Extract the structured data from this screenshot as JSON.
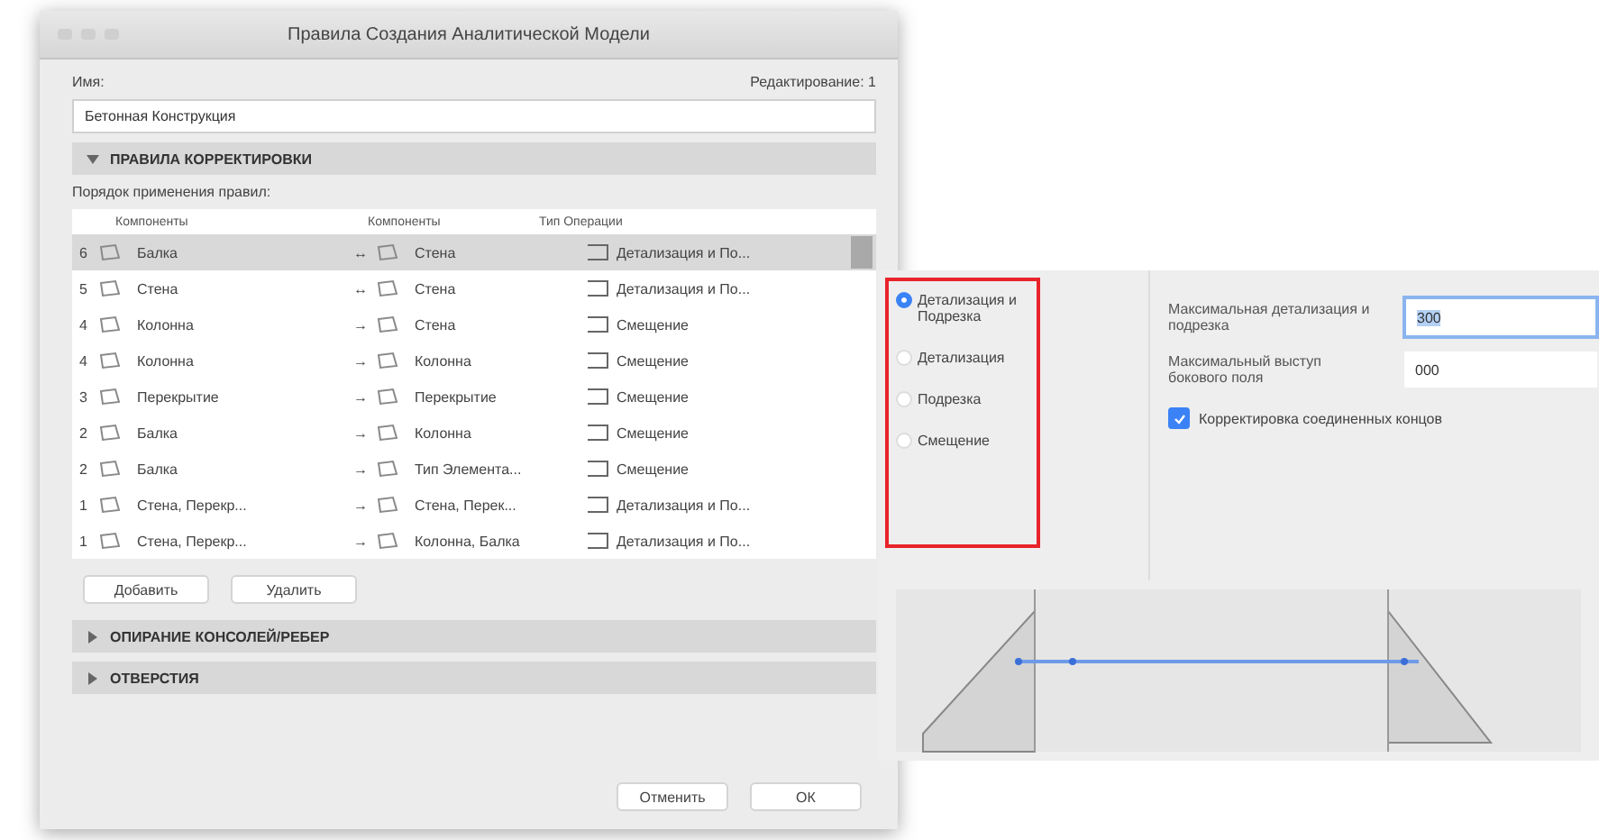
{
  "window": {
    "title": "Правила Создания Аналитической Модели"
  },
  "name_label": "Имя:",
  "edit_label": "Редактирование: 1",
  "name_value": "Бетонная Конструкция",
  "sections": [
    {
      "title": "ПРАВИЛА КОРРЕКТИРОВКИ",
      "expanded": true
    },
    {
      "title": "ОПИРАНИЕ КОНСОЛЕЙ/РЕБЕР",
      "expanded": false
    },
    {
      "title": "ОТВЕРСТИЯ",
      "expanded": false
    }
  ],
  "order_label": "Порядок применения правил:",
  "table": {
    "columns": [
      "Компоненты",
      "Компоненты",
      "Тип Операции"
    ],
    "rows": [
      {
        "priority": "6",
        "source": "Балка",
        "arrow": "↔",
        "target": "Стена",
        "operation": "Детализация и По...",
        "selected": true
      },
      {
        "priority": "5",
        "source": "Стена",
        "arrow": "↔",
        "target": "Стена",
        "operation": "Детализация и По...",
        "selected": false
      },
      {
        "priority": "4",
        "source": "Колонна",
        "arrow": "→",
        "target": "Стена",
        "operation": "Смещение",
        "selected": false
      },
      {
        "priority": "4",
        "source": "Колонна",
        "arrow": "→",
        "target": "Колонна",
        "operation": "Смещение",
        "selected": false
      },
      {
        "priority": "3",
        "source": "Перекрытие",
        "arrow": "→",
        "target": "Перекрытие",
        "operation": "Смещение",
        "selected": false
      },
      {
        "priority": "2",
        "source": "Балка",
        "arrow": "→",
        "target": "Колонна",
        "operation": "Смещение",
        "selected": false
      },
      {
        "priority": "2",
        "source": "Балка",
        "arrow": "→",
        "target": "Тип Элемента...",
        "operation": "Смещение",
        "selected": false
      },
      {
        "priority": "1",
        "source": "Стена, Перекр...",
        "arrow": "→",
        "target": "Стена, Перек...",
        "operation": "Детализация и По...",
        "selected": false
      },
      {
        "priority": "1",
        "source": "Стена, Перекр...",
        "arrow": "→",
        "target": "Колонна, Балка",
        "operation": "Детализация и По...",
        "selected": false
      }
    ]
  },
  "table_buttons": [
    "Добавить",
    "Удалить"
  ],
  "dialog_buttons": [
    "Отменить",
    "ОК"
  ],
  "options": [
    {
      "label": "Детализация и Подрезка",
      "selected": true
    },
    {
      "label": "Детализация",
      "selected": false
    },
    {
      "label": "Подрезка",
      "selected": false
    },
    {
      "label": "Смещение",
      "selected": false
    }
  ],
  "fields": [
    {
      "label": "Максимальная детализация и подрезка",
      "value": "300",
      "focused": true
    },
    {
      "label": "Максимальный выступ бокового поля",
      "value": "000",
      "focused": false
    }
  ],
  "adjust_ends": {
    "label": "Корректировка соединенных концов",
    "checked": true
  }
}
